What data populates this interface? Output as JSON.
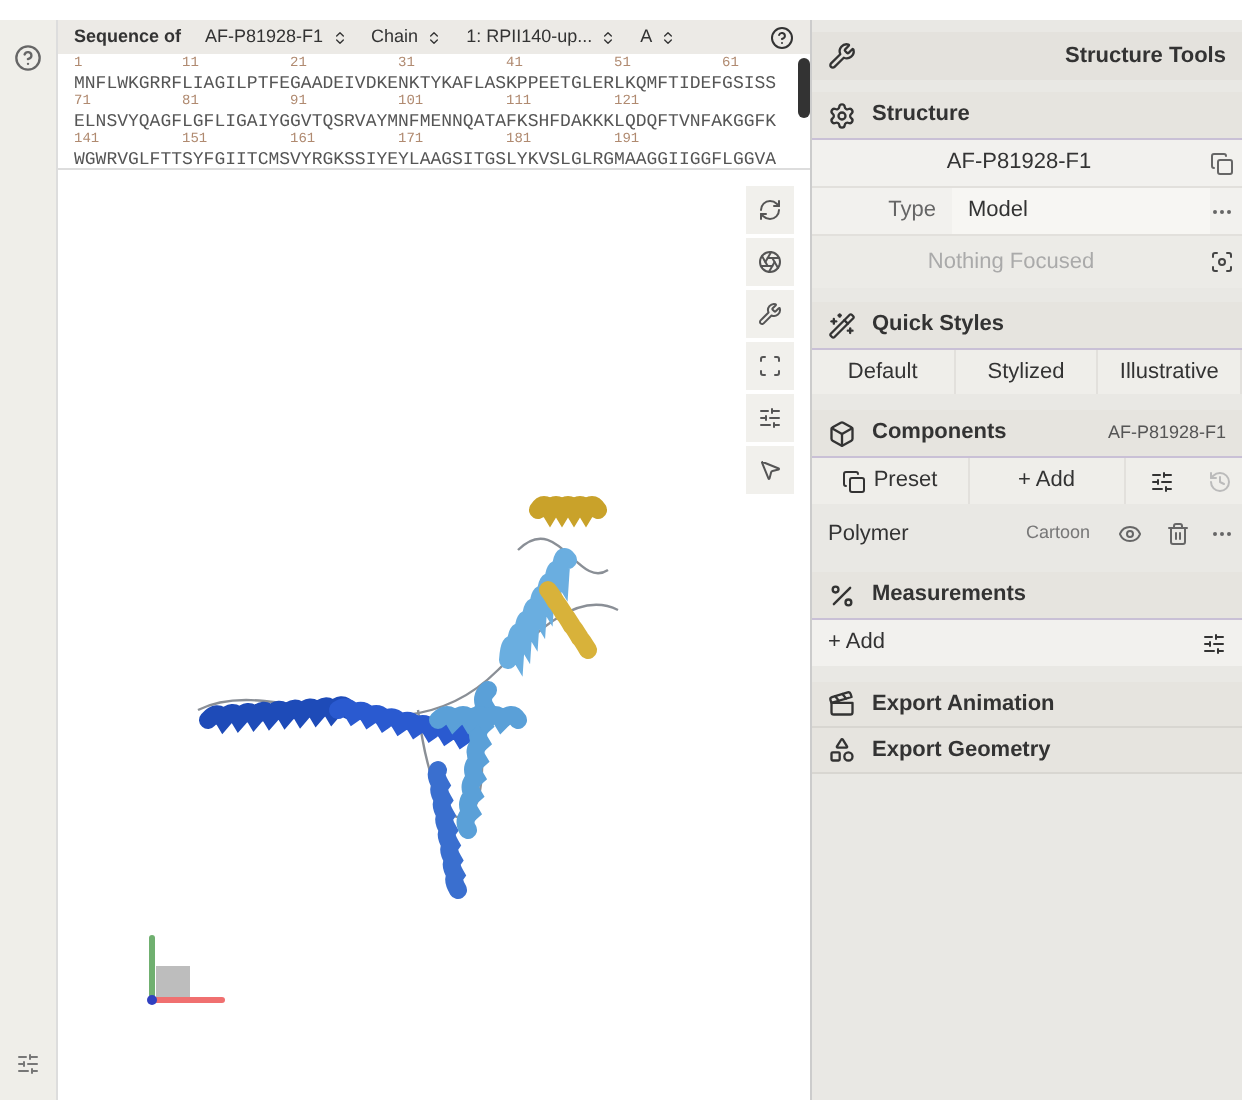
{
  "sequence_panel": {
    "label": "Sequence of",
    "selectors": [
      {
        "value": "AF-P81928-F1"
      },
      {
        "value": "Chain"
      },
      {
        "value": "1: RPII140-up..."
      },
      {
        "value": "A"
      }
    ],
    "rows": [
      {
        "numbers": [
          "1",
          "11",
          "21",
          "31",
          "41",
          "51",
          "61"
        ],
        "residues": "MNFLWKGRRFLIAGILPTFEGAADEIVDKENKTYKAFLASKPPEETGLERLKQMFTIDEFGSISS"
      },
      {
        "numbers": [
          "71",
          "81",
          "91",
          "101",
          "111",
          "121"
        ],
        "residues": "ELNSVYQAGFLGFLIGAIYGGVTQSRVAYMNFMENNQATAFKSHFDAKKKLQDQFTVNFAKGGFK"
      },
      {
        "numbers": [
          "141",
          "151",
          "161",
          "171",
          "181",
          "191"
        ],
        "residues": "WGWRVGLFTTSYFGIITCMSVYRGKSSIYEYLAAGSITGSLYKVSLGLRGMAAGGIIGGFLGGVA"
      }
    ]
  },
  "structure_tools": {
    "title": "Structure Tools",
    "structure": {
      "title": "Structure",
      "name": "AF-P81928-F1",
      "type_label": "Type",
      "type_value": "Model",
      "focus": "Nothing Focused"
    },
    "quick_styles": {
      "title": "Quick Styles",
      "buttons": [
        "Default",
        "Stylized",
        "Illustrative"
      ]
    },
    "components": {
      "title": "Components",
      "structure": "AF-P81928-F1",
      "preset": "Preset",
      "add": "+ Add",
      "items": [
        {
          "name": "Polymer",
          "representation": "Cartoon"
        }
      ]
    },
    "measurements": {
      "title": "Measurements",
      "add": "+ Add"
    },
    "exports": [
      {
        "kind": "animation",
        "title": "Export Animation"
      },
      {
        "kind": "geometry",
        "title": "Export Geometry"
      }
    ]
  }
}
